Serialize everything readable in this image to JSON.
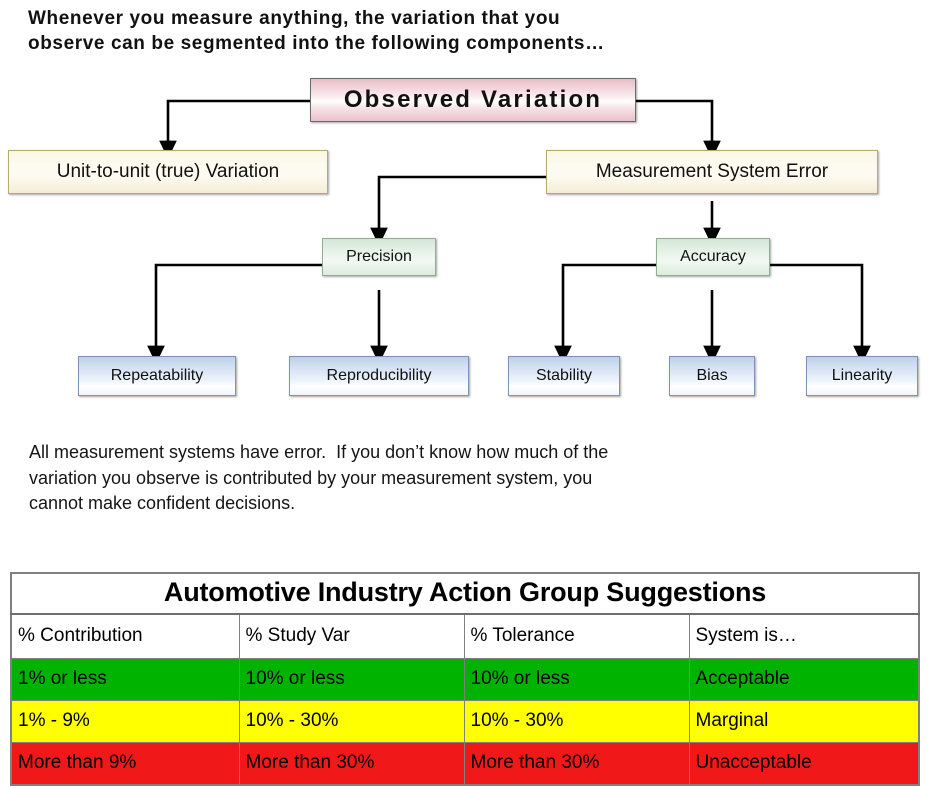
{
  "headline": {
    "line1": "Whenever you measure anything, the variation that you",
    "line2": "observe can be segmented into the following components…"
  },
  "diagram": {
    "title": "Observed Variation decomposition tree",
    "nodes": {
      "observed_variation": "Observed Variation",
      "unit_to_unit": "Unit-to-unit (true) Variation",
      "measurement_system_error": "Measurement System Error",
      "precision": "Precision",
      "accuracy": "Accuracy",
      "repeatability": "Repeatability",
      "reproducibility": "Reproducibility",
      "stability": "Stability",
      "bias": "Bias",
      "linearity": "Linearity"
    },
    "colors": {
      "level1_fill": "#e9c1cb",
      "level2_fill": "#fbf6e4",
      "level3_fill": "#d3e6d6",
      "level4_fill": "#bed0e8",
      "connector": "#000000"
    }
  },
  "body_paragraph": {
    "line1": "All measurement systems have error.  If you don’t know how much of the",
    "line2": "variation you observe is contributed by your measurement system, you",
    "line3": "cannot make confident decisions."
  },
  "aiag_table": {
    "title": "Automotive Industry Action Group Suggestions",
    "columns": [
      "% Contribution",
      "% Study Var",
      "% Tolerance",
      "System is…"
    ],
    "rows": [
      {
        "status": "acceptable",
        "color": "#00b300",
        "cells": [
          "1% or less",
          "10% or less",
          "10% or less",
          "Acceptable"
        ]
      },
      {
        "status": "marginal",
        "color": "#ffff00",
        "cells": [
          "1% - 9%",
          "10% - 30%",
          "10% - 30%",
          "Marginal"
        ]
      },
      {
        "status": "unacceptable",
        "color": "#f01818",
        "cells": [
          "More than 9%",
          "More than 30%",
          "More than 30%",
          "Unacceptable"
        ]
      }
    ]
  }
}
